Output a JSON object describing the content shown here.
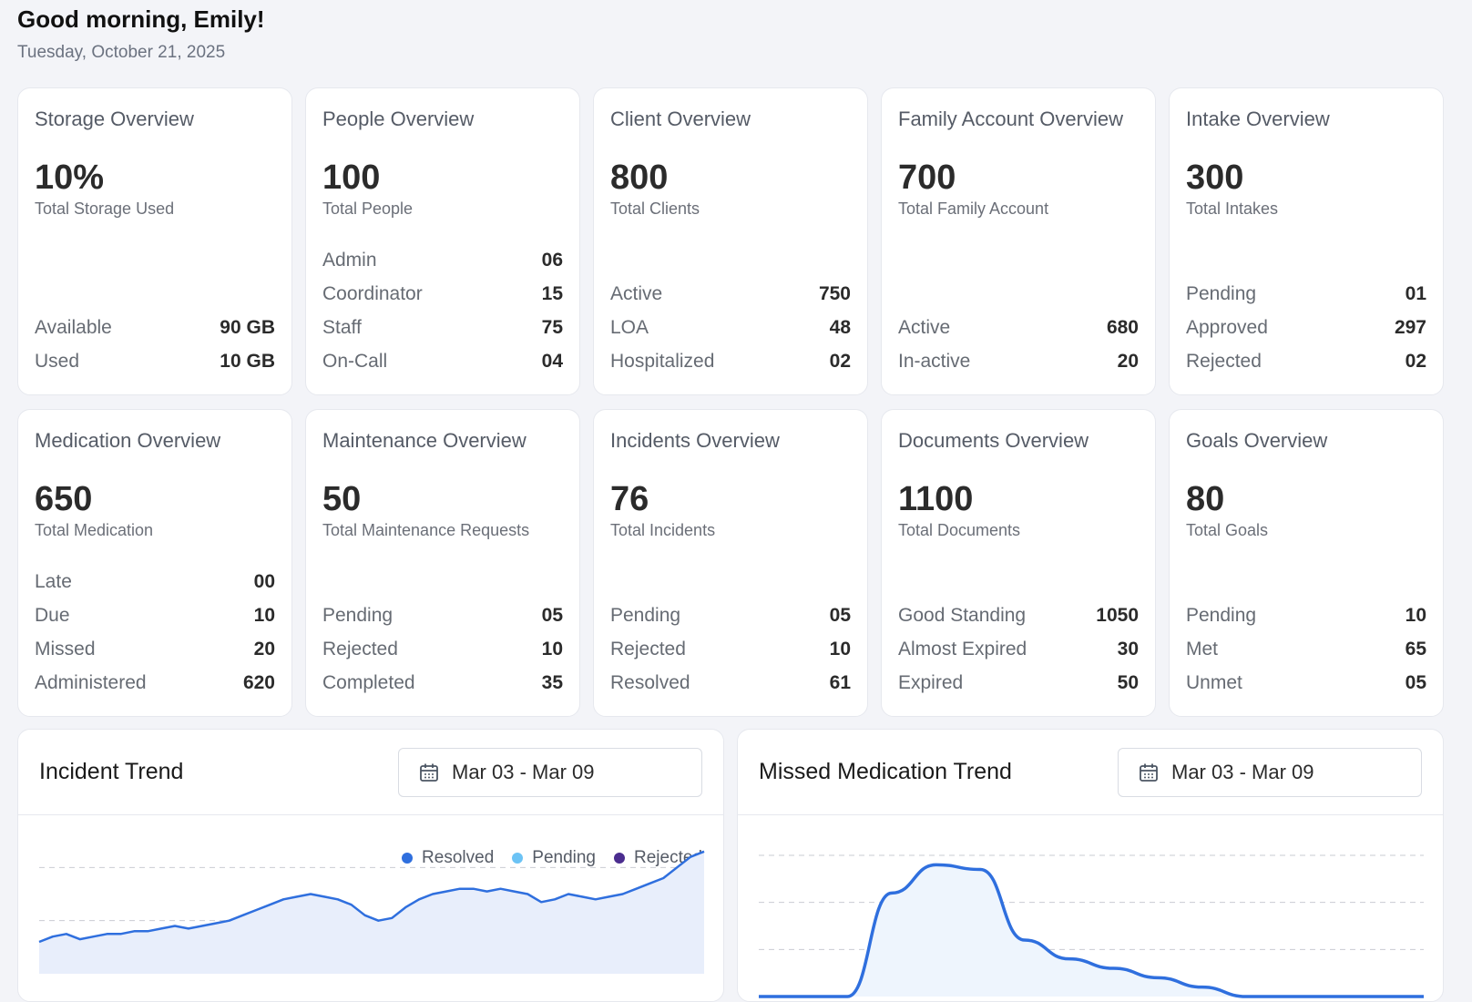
{
  "header": {
    "greeting": "Good morning, Emily!",
    "date": "Tuesday, October 21, 2025"
  },
  "cards": [
    {
      "title": "Storage Overview",
      "total": "10%",
      "subtitle": "Total Storage Used",
      "stats": [
        {
          "label": "Available",
          "value": "90 GB"
        },
        {
          "label": "Used",
          "value": "10 GB"
        }
      ]
    },
    {
      "title": "People Overview",
      "total": "100",
      "subtitle": "Total People",
      "stats": [
        {
          "label": "Admin",
          "value": "06"
        },
        {
          "label": "Coordinator",
          "value": "15"
        },
        {
          "label": "Staff",
          "value": "75"
        },
        {
          "label": "On-Call",
          "value": "04"
        }
      ]
    },
    {
      "title": "Client Overview",
      "total": "800",
      "subtitle": "Total Clients",
      "stats": [
        {
          "label": "Active",
          "value": "750"
        },
        {
          "label": "LOA",
          "value": "48"
        },
        {
          "label": "Hospitalized",
          "value": "02"
        }
      ]
    },
    {
      "title": "Family Account Overview",
      "total": "700",
      "subtitle": "Total Family Account",
      "stats": [
        {
          "label": "Active",
          "value": "680"
        },
        {
          "label": "In-active",
          "value": "20"
        }
      ]
    },
    {
      "title": "Intake Overview",
      "total": "300",
      "subtitle": "Total Intakes",
      "stats": [
        {
          "label": "Pending",
          "value": "01"
        },
        {
          "label": "Approved",
          "value": "297"
        },
        {
          "label": "Rejected",
          "value": "02"
        }
      ]
    },
    {
      "title": "Medication Overview",
      "total": "650",
      "subtitle": "Total Medication",
      "stats": [
        {
          "label": "Late",
          "value": "00"
        },
        {
          "label": "Due",
          "value": "10"
        },
        {
          "label": "Missed",
          "value": "20"
        },
        {
          "label": "Administered",
          "value": "620"
        }
      ]
    },
    {
      "title": "Maintenance Overview",
      "total": "50",
      "subtitle": "Total Maintenance Requests",
      "stats": [
        {
          "label": "Pending",
          "value": "05"
        },
        {
          "label": "Rejected",
          "value": "10"
        },
        {
          "label": "Completed",
          "value": "35"
        }
      ]
    },
    {
      "title": "Incidents Overview",
      "total": "76",
      "subtitle": "Total Incidents",
      "stats": [
        {
          "label": "Pending",
          "value": "05"
        },
        {
          "label": "Rejected",
          "value": "10"
        },
        {
          "label": "Resolved",
          "value": "61"
        }
      ]
    },
    {
      "title": "Documents Overview",
      "total": "1100",
      "subtitle": "Total Documents",
      "stats": [
        {
          "label": "Good Standing",
          "value": "1050"
        },
        {
          "label": "Almost Expired",
          "value": "30"
        },
        {
          "label": "Expired",
          "value": "50"
        }
      ]
    },
    {
      "title": "Goals Overview",
      "total": "80",
      "subtitle": "Total Goals",
      "stats": [
        {
          "label": "Pending",
          "value": "10"
        },
        {
          "label": "Met",
          "value": "65"
        },
        {
          "label": "Unmet",
          "value": "05"
        }
      ]
    }
  ],
  "incident_trend": {
    "title": "Incident Trend",
    "date_range": "Mar 03 - Mar 09",
    "calendar_icon": "calendar-icon",
    "legend": [
      {
        "label": "Resolved",
        "color": "#2f6fde"
      },
      {
        "label": "Pending",
        "color": "#6cc3f5"
      },
      {
        "label": "Rejected",
        "color": "#4b2d8f"
      }
    ]
  },
  "missed_medication_trend": {
    "title": "Missed Medication Trend",
    "date_range": "Mar 03 - Mar 09",
    "calendar_icon": "calendar-icon"
  },
  "chart_data": [
    {
      "type": "area",
      "title": "Incident Trend",
      "series": [
        {
          "name": "Resolved",
          "color": "#2f6fde",
          "values": [
            6,
            7,
            7.5,
            6.5,
            7,
            7.5,
            7.5,
            8,
            8,
            8.5,
            9,
            8.5,
            9,
            9.5,
            10,
            11,
            12,
            13,
            14,
            14.5,
            15,
            14.5,
            14,
            13,
            11,
            10,
            10.5,
            12.5,
            14,
            15,
            15.5,
            16,
            16,
            15.5,
            16,
            15.5,
            15,
            13.5,
            14,
            15,
            14.5,
            14,
            14.5,
            15,
            16,
            17,
            18,
            20,
            22,
            23
          ]
        }
      ],
      "ylim": [
        0,
        30
      ],
      "grid": true
    },
    {
      "type": "area",
      "title": "Missed Medication Trend",
      "series": [
        {
          "values": [
            0,
            0,
            0,
            22,
            28,
            27,
            12,
            8,
            6,
            4,
            2,
            0,
            0,
            0,
            0,
            0
          ]
        }
      ],
      "ylim": [
        0,
        30
      ],
      "grid": true
    }
  ]
}
